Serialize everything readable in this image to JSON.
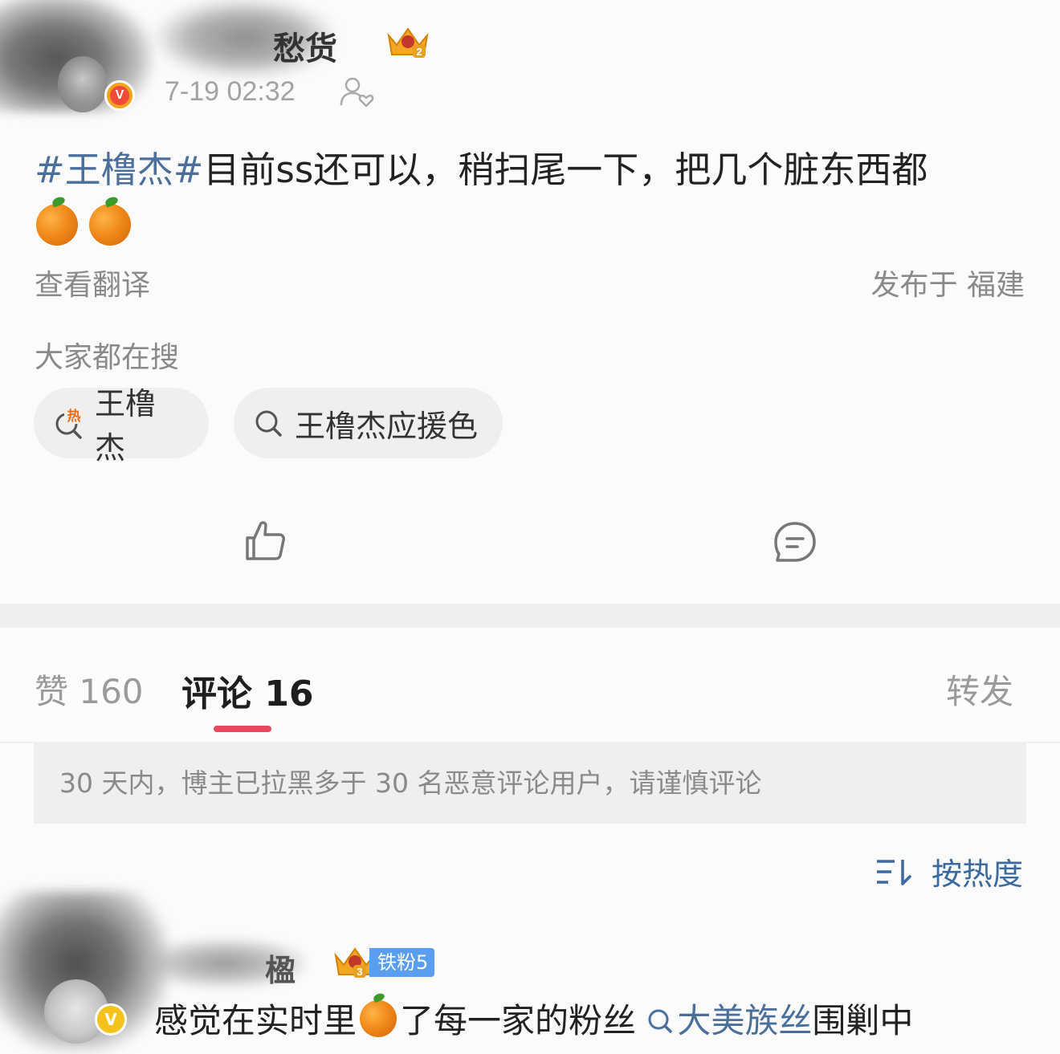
{
  "post": {
    "username": "愁货",
    "timestamp": "7-19 02:32",
    "topic": "#王橹杰#",
    "text": "目前ss还可以，稍扫尾一下，把几个脏东西都",
    "emojis": [
      "orange-emoji",
      "orange-emoji"
    ],
    "translate_label": "查看翻译",
    "location": "发布于 福建",
    "verified_badge": "V",
    "crown_level": "2"
  },
  "hot_search": {
    "title": "大家都在搜",
    "chips": [
      {
        "label": "王橹杰",
        "icon": "hot-search-icon",
        "hot_tag": "热"
      },
      {
        "label": "王橹杰应援色",
        "icon": "search-icon"
      }
    ]
  },
  "actions": {
    "like_icon": "thumbs-up-icon",
    "comment_icon": "comment-bubble-icon"
  },
  "tabs": {
    "like_label": "赞 160",
    "comment_label": "评论 16",
    "repost_label": "转发",
    "active": "comment",
    "accent_color": "#e8475f"
  },
  "notice": "30 天内，博主已拉黑多于 30 名恶意评论用户，请谨慎评论",
  "sort": {
    "label": "按热度",
    "icon": "sort-icon",
    "color": "#3b6aa0"
  },
  "comment": {
    "username": "楹",
    "fan_badge": "铁粉5",
    "crown_level": "3",
    "verified_badge": "V",
    "text_before": "感觉在实时里",
    "text_after": "了每一家的粉丝",
    "link_text": "大美族丝",
    "text_end": "围剿中"
  },
  "colors": {
    "topic": "#4a6f9c",
    "muted": "#8a8a8a",
    "background": "#fbfbfb"
  }
}
